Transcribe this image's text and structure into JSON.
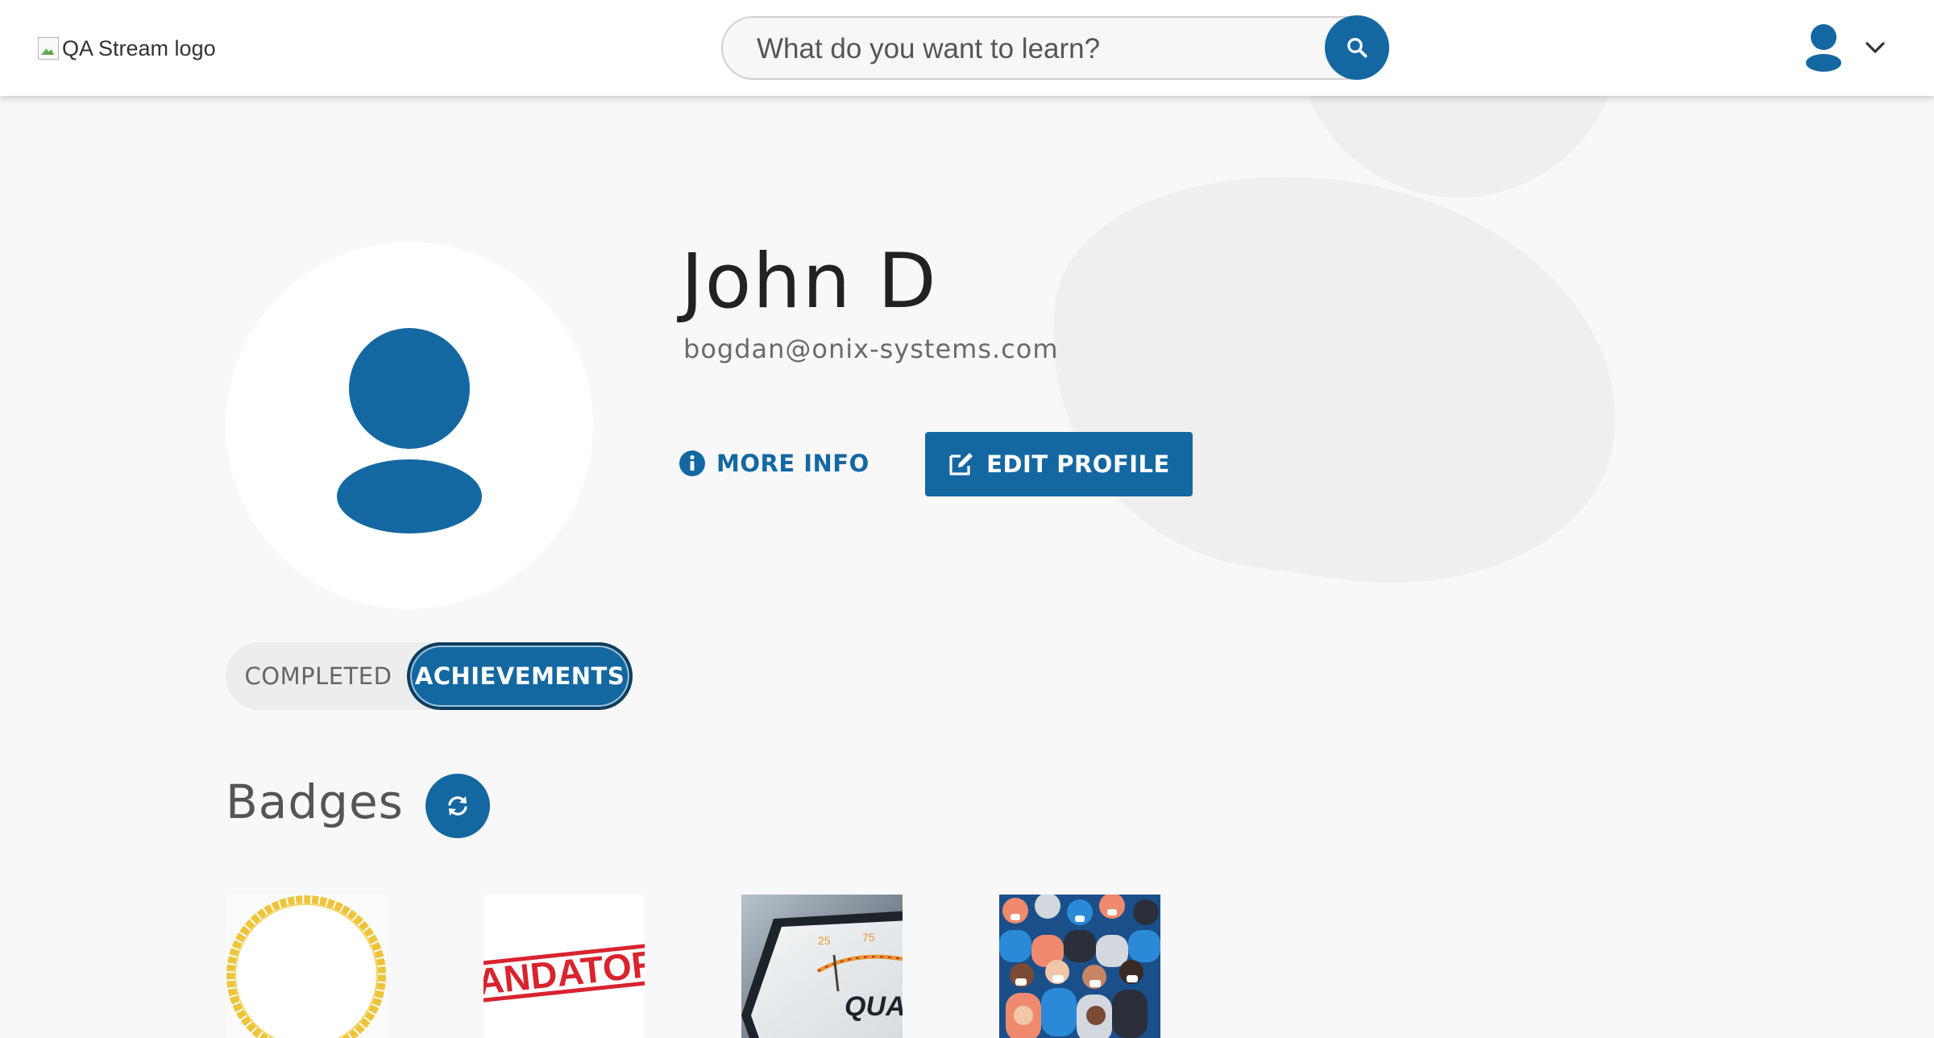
{
  "header": {
    "logo_alt": "QA Stream logo",
    "search_placeholder": "What do you want to learn?",
    "search_icon": "search-icon",
    "user_icon": "user-icon",
    "chevron_icon": "chevron-down-icon"
  },
  "profile": {
    "name": "John D",
    "email": "bogdan@onix-systems.com",
    "avatar_icon": "user-icon",
    "more_info_label": "MORE INFO",
    "more_info_icon": "info-icon",
    "edit_profile_label": "EDIT PROFILE",
    "edit_profile_icon": "edit-icon"
  },
  "tabs": [
    {
      "label": "COMPLETED",
      "active": false
    },
    {
      "label": "ACHIEVEMENTS",
      "active": true
    }
  ],
  "badges": {
    "title": "Badges",
    "refresh_icon": "refresh-icon",
    "items": [
      {
        "image": "gold-ring-badge"
      },
      {
        "image": "mandatory-stamp-badge",
        "text": "MANDATORY"
      },
      {
        "image": "quality-gauge-badge",
        "text": "QUAL"
      },
      {
        "image": "crowd-masks-badge"
      }
    ]
  },
  "colors": {
    "accent": "#1468a2",
    "background": "#f8f8f8",
    "badge_gold": "#eec43a",
    "stamp_red": "#d9232e"
  }
}
